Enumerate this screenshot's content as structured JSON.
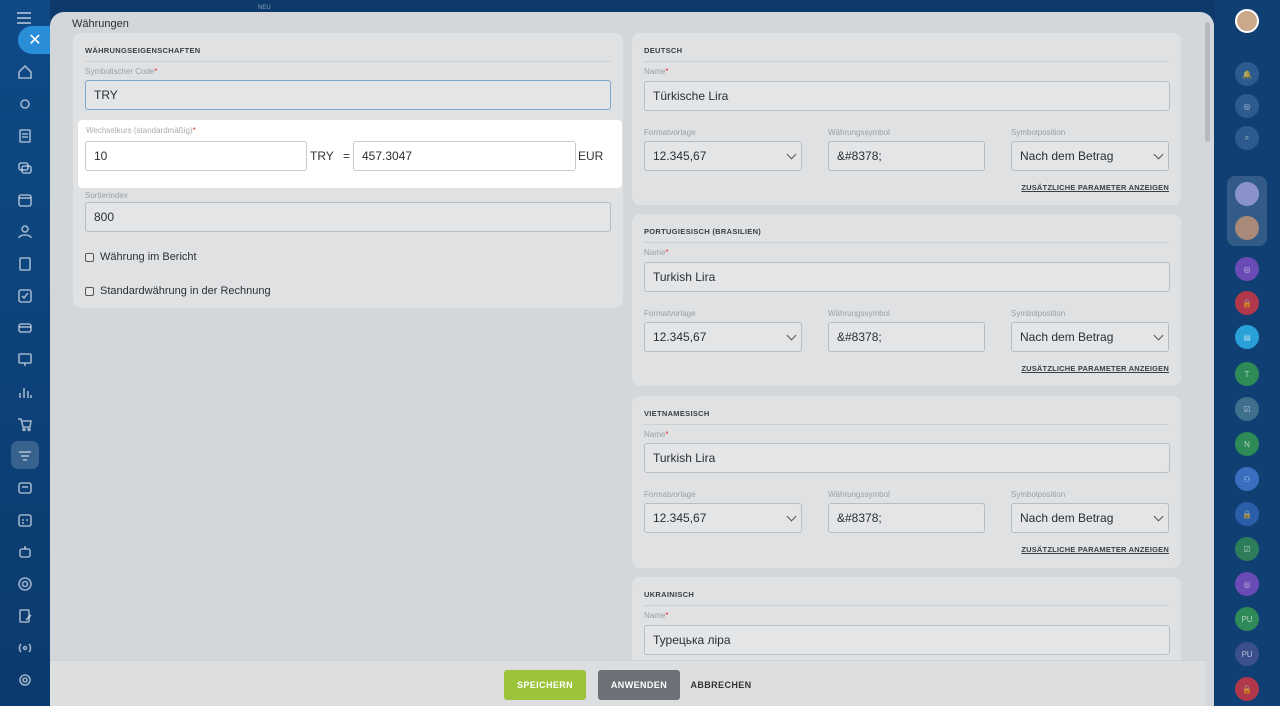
{
  "top_badge": "NEU",
  "panel": {
    "title": "Währungen"
  },
  "properties": {
    "title": "WÄHRUNGSEIGENSCHAFTEN",
    "code_label": "Symbolischer Code",
    "code_value": "TRY",
    "rate_label": "Wechselkurs (standardmäßig)",
    "rate_amount": "10",
    "rate_from_currency": "TRY",
    "rate_equals": "=",
    "rate_value": "457.3047",
    "rate_to_currency": "EUR",
    "sort_label": "Sortierindex",
    "sort_value": "800",
    "checkbox_report": "Währung im Bericht",
    "checkbox_invoice": "Standardwährung in der Rechnung",
    "required_mark": "*"
  },
  "languages": [
    {
      "title": "DEUTSCH",
      "name_label": "Name",
      "name_value": "Türkische Lira",
      "format_label": "Formatvorlage",
      "format_value": "12.345,67",
      "symbol_label": "Währungssymbol",
      "symbol_value": "&#8378;",
      "position_label": "Symbolposition",
      "position_value": "Nach dem Betrag",
      "more_link": "ZUSÄTZLICHE PARAMETER ANZEIGEN"
    },
    {
      "title": "PORTUGIESISCH (BRASILIEN)",
      "name_label": "Name",
      "name_value": "Turkish Lira",
      "format_label": "Formatvorlage",
      "format_value": "12.345,67",
      "symbol_label": "Währungssymbol",
      "symbol_value": "&#8378;",
      "position_label": "Symbolposition",
      "position_value": "Nach dem Betrag",
      "more_link": "ZUSÄTZLICHE PARAMETER ANZEIGEN"
    },
    {
      "title": "VIETNAMESISCH",
      "name_label": "Name",
      "name_value": "Turkish Lira",
      "format_label": "Formatvorlage",
      "format_value": "12.345,67",
      "symbol_label": "Währungssymbol",
      "symbol_value": "&#8378;",
      "position_label": "Symbolposition",
      "position_value": "Nach dem Betrag",
      "more_link": "ZUSÄTZLICHE PARAMETER ANZEIGEN"
    },
    {
      "title": "UKRAINISCH",
      "name_label": "Name",
      "name_value": "Турецька ліра"
    }
  ],
  "footer": {
    "save": "SPEICHERN",
    "apply": "ANWENDEN",
    "cancel": "ABBRECHEN"
  },
  "right_bar_badges": [
    "T",
    "N",
    "PU",
    "PU"
  ],
  "colors": {
    "save_button": "#9cc43a",
    "apply_button": "#6b7176",
    "accent": "#2a8dd8",
    "required": "#e53935"
  }
}
